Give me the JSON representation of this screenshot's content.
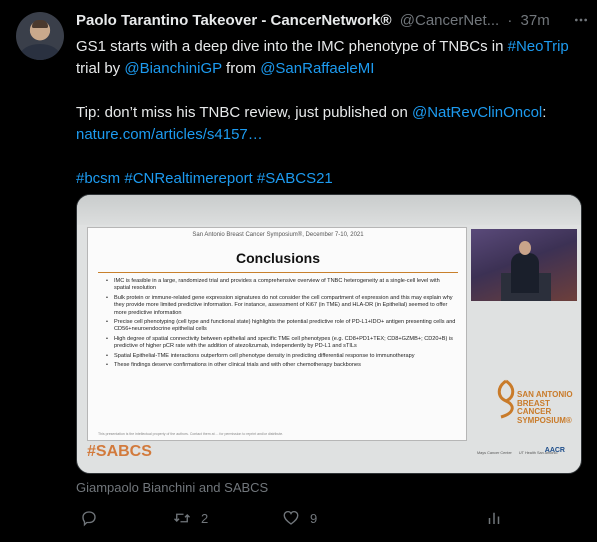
{
  "author": {
    "name": "Paolo Tarantino Takeover - CancerNetwork®",
    "handle": "@CancerNet...",
    "separator": "·",
    "time": "37m"
  },
  "tweet": {
    "line1_prefix": "GS1 starts with a deep dive into the IMC phenotype of TNBCs in ",
    "line1_hashtag": "#NeoTrip",
    "line2_prefix": "trial by ",
    "line2_mention1": "@BianchiniGP",
    "line2_mid": " from ",
    "line2_mention2": "@SanRaffaeleMI",
    "line3_prefix": "Tip: don’t miss his TNBC review, just published on ",
    "line3_mention": "@NatRevClinOncol",
    "line3_suffix": ":",
    "line4_link": "nature.com/articles/s4157…",
    "hashtags": "#bcsm #CNRealtimereport #SABCS21"
  },
  "slide": {
    "header": "San Antonio Breast Cancer Symposium®, December 7-10, 2021",
    "title": "Conclusions",
    "bullets": [
      "IMC is feasible in a large, randomized trial and provides a comprehensive overview of TNBC heterogeneity at a single-cell level with spatial resolution",
      "Bulk protein or immune-related gene expression signatures do not consider the cell compartment of expression and this may explain why they provide more limited predictive information. For instance, assessment of Ki67 (in TME) and HLA-DR (in Epithelial) seemed to offer more predictive information",
      "Precise cell phenotyping (cell type and functional state) highlights the potential predictive role of PD-L1+IDO+ antigen presenting cells and CD56+neuroendocrine epithelial cells",
      "High degree of spatial connectivity between epithelial and specific TME cell phenotypes (e.g. CD8+PD1+TEX; CD8+GZMB+; CD20+B) is predictive of higher pCR rate with the addition of atezolizumab, independently by PD-L1 and sTILs",
      "Spatial Epithelial-TME interactions outperform cell phenotype density in predicting differential response to immunotherapy",
      "These findings deserve confirmations in other clinical trials and with other chemotherapy backbones"
    ],
    "footer": "This presentation is the intellectual property of the authors. Contact them at ... for permission to reprint and/or distribute.",
    "banner_hashtag": "#SABCS",
    "logo_text": "SAN ANTONIO BREAST CANCER SYMPOSIUM®",
    "partners": [
      "Mays Cancer Center",
      "UT Health San Antonio"
    ],
    "partner_aacr": "AACR"
  },
  "caption": "Giampaolo Bianchini and SABCS",
  "actions": {
    "reply_count": "",
    "retweet_count": "2",
    "like_count": "9"
  },
  "colors": {
    "background": "#000000",
    "link": "#1d9bf0",
    "muted": "#71767b",
    "sabcs_orange": "#c97b2a"
  }
}
